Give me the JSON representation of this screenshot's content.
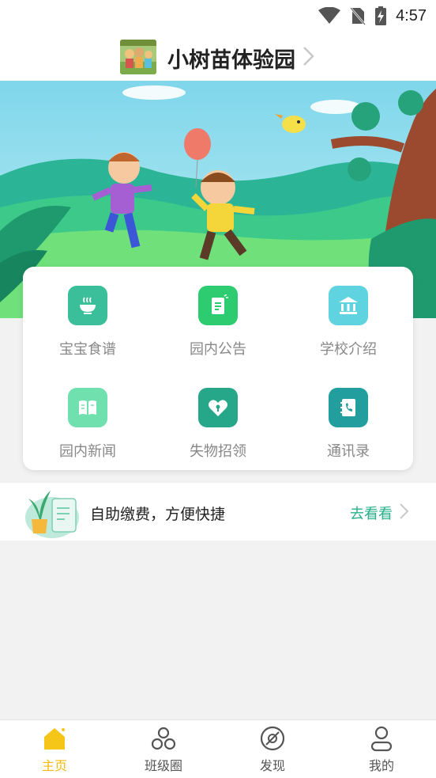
{
  "status_bar": {
    "time": "4:57",
    "icons": [
      "wifi-icon",
      "no-sim-icon",
      "battery-charging-icon"
    ]
  },
  "header": {
    "school_name": "小树苗体验园",
    "thumbnail_icon": "school-photo"
  },
  "banner": {
    "illustration": "children-playing-with-balloon"
  },
  "features": [
    {
      "label": "宝宝食谱",
      "icon": "bowl-icon",
      "color": "#3bbf9a"
    },
    {
      "label": "园内公告",
      "icon": "notice-icon",
      "color": "#2ecc71"
    },
    {
      "label": "学校介绍",
      "icon": "school-building-icon",
      "color": "#5fd3e0"
    },
    {
      "label": "园内新闻",
      "icon": "book-icon",
      "color": "#6fe0ae"
    },
    {
      "label": "失物招领",
      "icon": "lock-heart-icon",
      "color": "#26a789"
    },
    {
      "label": "通讯录",
      "icon": "phone-book-icon",
      "color": "#229e9e"
    }
  ],
  "promo": {
    "text": "自助缴费，方便快捷",
    "link": "去看看",
    "link_color": "#27b08a",
    "icon": "plant-bill-icon"
  },
  "bottom_nav": [
    {
      "label": "主页",
      "icon": "home-icon",
      "active": true
    },
    {
      "label": "班级圈",
      "icon": "circles-icon",
      "active": false
    },
    {
      "label": "发现",
      "icon": "compass-icon",
      "active": false
    },
    {
      "label": "我的",
      "icon": "person-icon",
      "active": false
    }
  ],
  "colors": {
    "active_nav": "#f5b80b",
    "accent_green": "#27b08a"
  }
}
